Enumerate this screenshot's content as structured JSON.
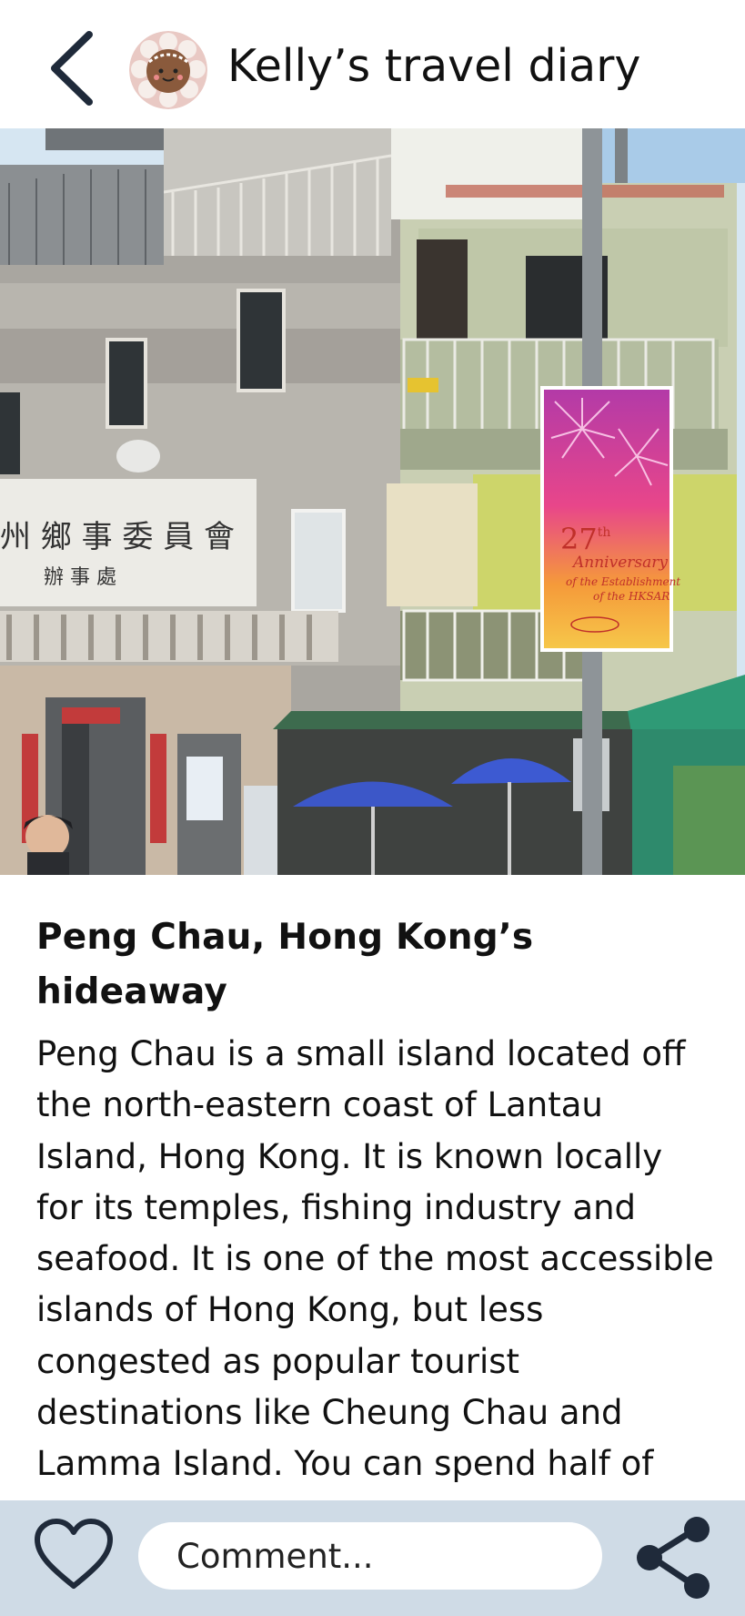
{
  "header": {
    "title": "Kelly’s travel diary",
    "back_icon": "chevron-left-icon",
    "avatar_icon": "smiling-cookie-avatar"
  },
  "photo": {
    "sign_text": "州 鄉 事 委 員 會",
    "sign_subtext": "辦 事 處",
    "banner_number": "27",
    "banner_suffix": "th",
    "banner_line1": "Anniversary",
    "banner_line2": "of the Establishment",
    "banner_line3": "of the HKSAR"
  },
  "article": {
    "title": "Peng Chau, Hong Kong’s hideaway",
    "body": "Peng Chau is a small island located off the north-eastern coast of Lantau Island, Hong Kong. It is known locally for its temples, fishing industry and seafood. It is one of the most accessible islands of Hong Kong, but less congested as popular tourist destinations like Cheung Chau and Lamma Island. You can spend half of your day hiking and another half on the beach."
  },
  "bottom_bar": {
    "like_icon": "heart-icon",
    "comment_placeholder": "Comment...",
    "share_icon": "share-icon"
  },
  "colors": {
    "bottom_bar_bg": "#cfdbe6",
    "icon_dark": "#1f2a3a",
    "text": "#111111"
  }
}
